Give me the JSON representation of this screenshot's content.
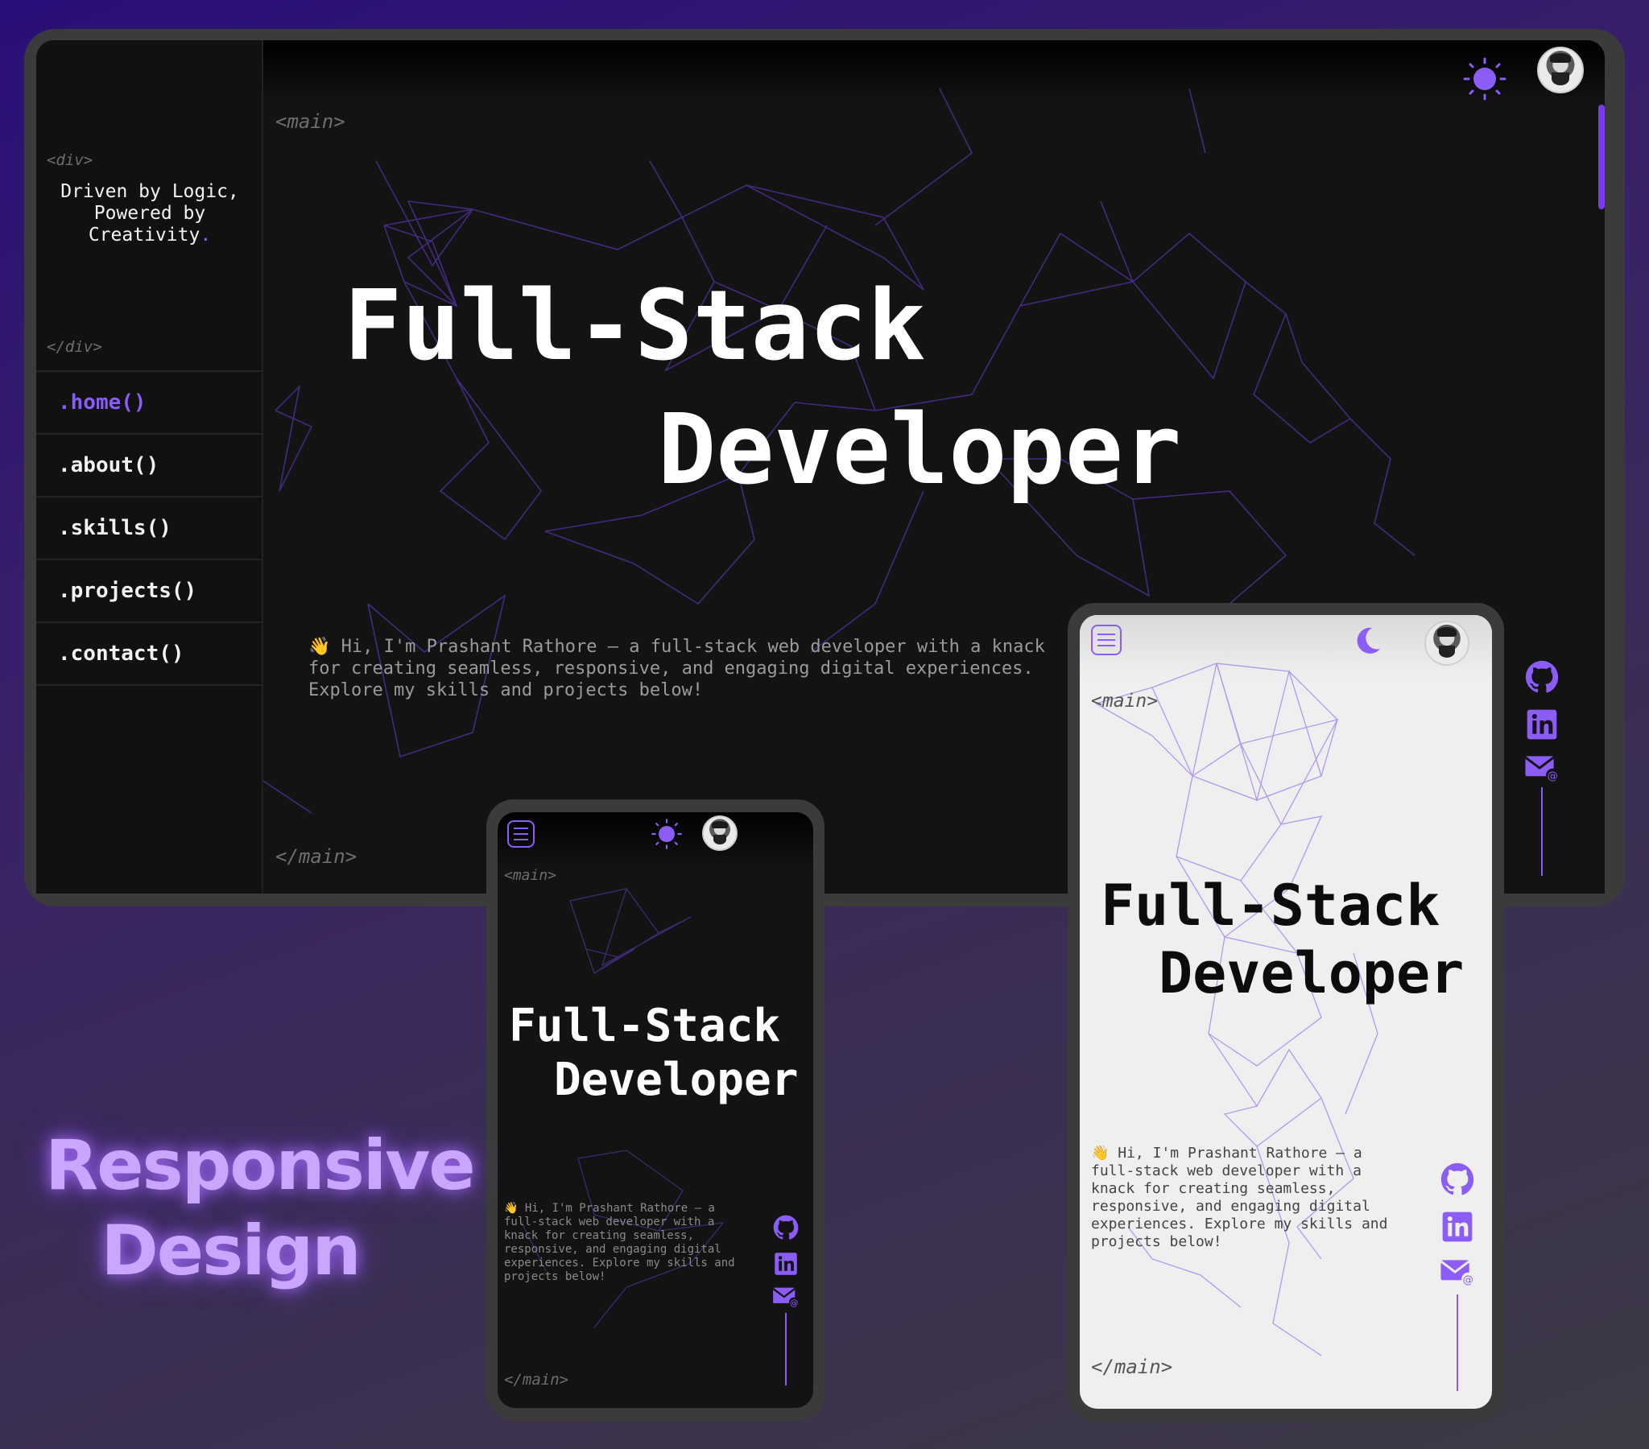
{
  "colors": {
    "accent": "#8b5cf6",
    "dark_bg": "#131314",
    "light_bg": "#efeff0",
    "frame": "#3b3b3b"
  },
  "tags": {
    "div_open": "<div>",
    "div_close": "</div>",
    "main_open": "<main>",
    "main_close": "</main>"
  },
  "sidebar": {
    "tagline_part1": "Driven by Logic,\nPowered by\nCreativity",
    "tagline_dot": ".",
    "nav": [
      {
        "label": ".home()",
        "active": true
      },
      {
        "label": ".about()",
        "active": false
      },
      {
        "label": ".skills()",
        "active": false
      },
      {
        "label": ".projects()",
        "active": false
      },
      {
        "label": ".contact()",
        "active": false
      }
    ]
  },
  "hero": {
    "title_line1": "Full-Stack",
    "title_line2": "Developer",
    "intro": "👋 Hi, I'm Prashant Rathore – a full-stack web developer with a knack for creating seamless, responsive, and engaging digital experiences. Explore my skills and projects below!"
  },
  "icons": {
    "theme_light": "sun-icon",
    "theme_dark": "moon-icon",
    "menu": "hamburger-menu-icon",
    "social": [
      "github-icon",
      "linkedin-icon",
      "email-icon"
    ]
  },
  "caption": {
    "line1": "Responsive",
    "line2": "Design"
  }
}
